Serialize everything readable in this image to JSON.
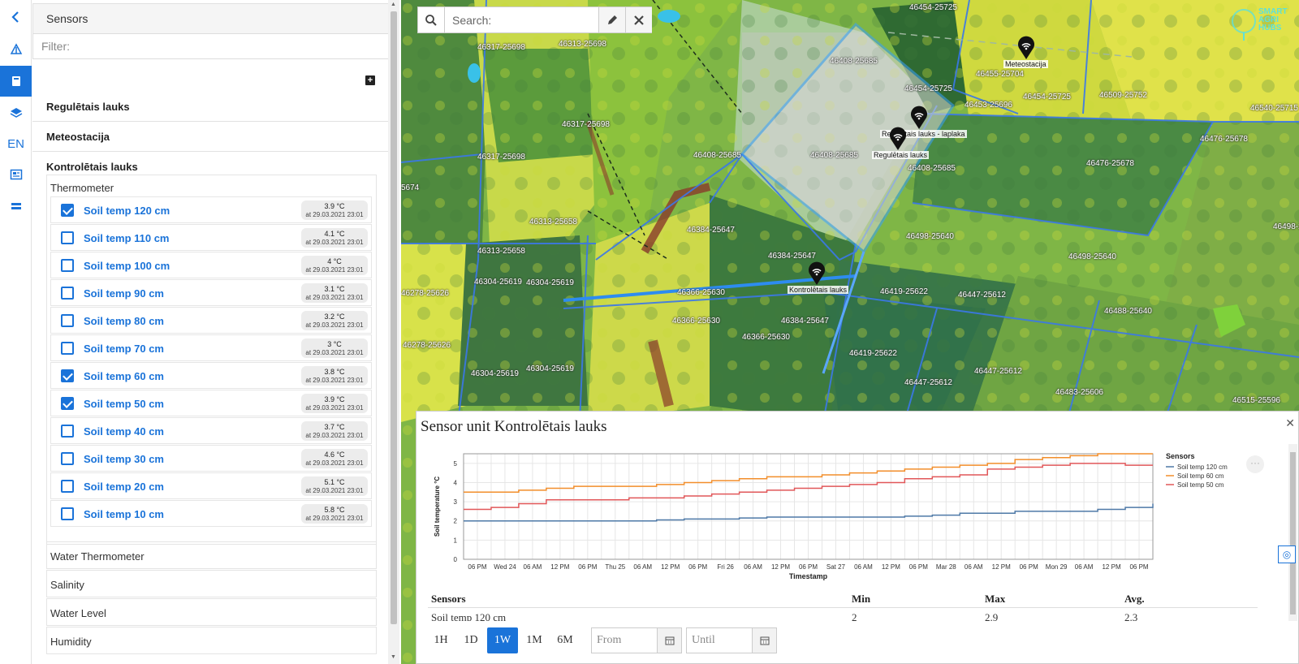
{
  "toolbar": {
    "items": [
      {
        "icon": "chevron-left-icon",
        "glyph": "‹"
      },
      {
        "icon": "satellite-icon",
        "glyph": ""
      },
      {
        "icon": "sensor-icon",
        "glyph": ""
      },
      {
        "icon": "layers-icon",
        "glyph": ""
      },
      {
        "icon": "language",
        "glyph": "EN"
      },
      {
        "icon": "news-icon",
        "glyph": ""
      },
      {
        "icon": "menu-icon",
        "glyph": ""
      }
    ]
  },
  "panel": {
    "title": "Sensors",
    "filter_placeholder": "Filter:",
    "groups": [
      "Regulētais lauks",
      "Meteostacija",
      "Kontrolētais lauks"
    ],
    "thermometer": {
      "title": "Thermometer",
      "sensors": [
        {
          "label": "Soil temp 120 cm",
          "value": "3.9 °C",
          "time": "at 29.03.2021 23:01",
          "checked": true
        },
        {
          "label": "Soil temp 110 cm",
          "value": "4.1 °C",
          "time": "at 29.03.2021 23:01",
          "checked": false
        },
        {
          "label": "Soil temp 100 cm",
          "value": "4 °C",
          "time": "at 29.03.2021 23:01",
          "checked": false
        },
        {
          "label": "Soil temp 90 cm",
          "value": "3.1 °C",
          "time": "at 29.03.2021 23:01",
          "checked": false
        },
        {
          "label": "Soil temp 80 cm",
          "value": "3.2 °C",
          "time": "at 29.03.2021 23:01",
          "checked": false
        },
        {
          "label": "Soil temp 70 cm",
          "value": "3 °C",
          "time": "at 29.03.2021 23:01",
          "checked": false
        },
        {
          "label": "Soil temp 60 cm",
          "value": "3.8 °C",
          "time": "at 29.03.2021 23:01",
          "checked": true
        },
        {
          "label": "Soil temp 50 cm",
          "value": "3.9 °C",
          "time": "at 29.03.2021 23:01",
          "checked": true
        },
        {
          "label": "Soil temp 40 cm",
          "value": "3.7 °C",
          "time": "at 29.03.2021 23:01",
          "checked": false
        },
        {
          "label": "Soil temp 30 cm",
          "value": "4.6 °C",
          "time": "at 29.03.2021 23:01",
          "checked": false
        },
        {
          "label": "Soil temp 20 cm",
          "value": "5.1 °C",
          "time": "at 29.03.2021 23:01",
          "checked": false
        },
        {
          "label": "Soil temp 10 cm",
          "value": "5.8 °C",
          "time": "at 29.03.2021 23:01",
          "checked": false
        }
      ]
    },
    "categories": [
      "Water Thermometer",
      "Salinity",
      "Water Level",
      "Humidity"
    ]
  },
  "map": {
    "search_placeholder": "Search:",
    "parcels": [
      "46454-25725",
      "46317-25698",
      "46313-25698",
      "46408-25685",
      "46454-25725",
      "46455-25704",
      "46453-25696",
      "46454-25725",
      "46509-25752",
      "46540-25715",
      "46317-25698",
      "46317-25698",
      "46408-25685",
      "46408-25685",
      "46476-25678",
      "46476-25678",
      "46408-25685",
      "46313-25658",
      "46384-25647",
      "46498-25640",
      "46498-25640",
      "46313-25658",
      "46384-25647",
      "46304-25619",
      "46304-25619",
      "46366-25630",
      "46419-25622",
      "46447-25612",
      "46278-25626",
      "46366-25630",
      "46384-25647",
      "46488-25640",
      "46278-25626",
      "46366-25630",
      "46304-25619",
      "46304-25619",
      "46419-25622",
      "46447-25612",
      "46447-25612",
      "46483-25606",
      "46515-25596",
      "46498-25640",
      "5674"
    ],
    "markers": [
      "Meteostacija",
      "Regulētais lauks - laplaka",
      "Regulētais lauks",
      "Kontrolētais lauks"
    ],
    "logo_text": "SMART\nAGRI\nHUBS"
  },
  "popup": {
    "title": "Sensor unit Kontrolētais lauks",
    "stats_headers": [
      "Sensors",
      "Min",
      "Max",
      "Avg."
    ],
    "stats_row": [
      "Soil temp 120 cm",
      "2",
      "2.9",
      "2.3"
    ],
    "ranges": [
      "1H",
      "1D",
      "1W",
      "1M",
      "6M"
    ],
    "active_range": "1W",
    "from_placeholder": "From",
    "until_placeholder": "Until"
  },
  "chart_data": {
    "type": "line",
    "title": "",
    "xlabel": "Timestamp",
    "ylabel": "Soil temperature °C",
    "ylim": [
      0,
      5.5
    ],
    "yticks": [
      0,
      1,
      2,
      3,
      4,
      5
    ],
    "xticks": [
      "06 PM",
      "Wed 24",
      "06 AM",
      "12 PM",
      "06 PM",
      "Thu 25",
      "06 AM",
      "12 PM",
      "06 PM",
      "Fri 26",
      "06 AM",
      "12 PM",
      "06 PM",
      "Sat 27",
      "06 AM",
      "12 PM",
      "06 PM",
      "Mar 28",
      "06 AM",
      "12 PM",
      "06 PM",
      "Mon 29",
      "06 AM",
      "12 PM",
      "06 PM"
    ],
    "legend_title": "Sensors",
    "legend_position": "right",
    "x": [
      0,
      1,
      2,
      3,
      4,
      5,
      6,
      7,
      8,
      9,
      10,
      11,
      12,
      13,
      14,
      15,
      16,
      17,
      18,
      19,
      20,
      21,
      22,
      23,
      24,
      25
    ],
    "series": [
      {
        "name": "Soil temp 120 cm",
        "color": "#4e79a7",
        "values": [
          2.0,
          2.0,
          2.0,
          2.0,
          2.0,
          2.0,
          2.0,
          2.05,
          2.1,
          2.1,
          2.15,
          2.2,
          2.2,
          2.2,
          2.2,
          2.2,
          2.25,
          2.3,
          2.4,
          2.4,
          2.5,
          2.5,
          2.5,
          2.6,
          2.7,
          2.9
        ]
      },
      {
        "name": "Soil temp 60 cm",
        "color": "#f28e2b",
        "values": [
          3.5,
          3.5,
          3.6,
          3.7,
          3.8,
          3.8,
          3.8,
          3.9,
          4.0,
          4.1,
          4.2,
          4.3,
          4.3,
          4.4,
          4.5,
          4.6,
          4.7,
          4.8,
          4.9,
          5.0,
          5.2,
          5.3,
          5.4,
          5.5,
          5.5,
          5.5
        ]
      },
      {
        "name": "Soil temp 50 cm",
        "color": "#e15759",
        "values": [
          2.6,
          2.7,
          2.9,
          3.1,
          3.1,
          3.1,
          3.2,
          3.2,
          3.3,
          3.4,
          3.5,
          3.6,
          3.7,
          3.8,
          3.9,
          4.0,
          4.2,
          4.3,
          4.4,
          4.7,
          4.8,
          4.9,
          5.0,
          5.0,
          4.9,
          4.9
        ]
      }
    ]
  }
}
